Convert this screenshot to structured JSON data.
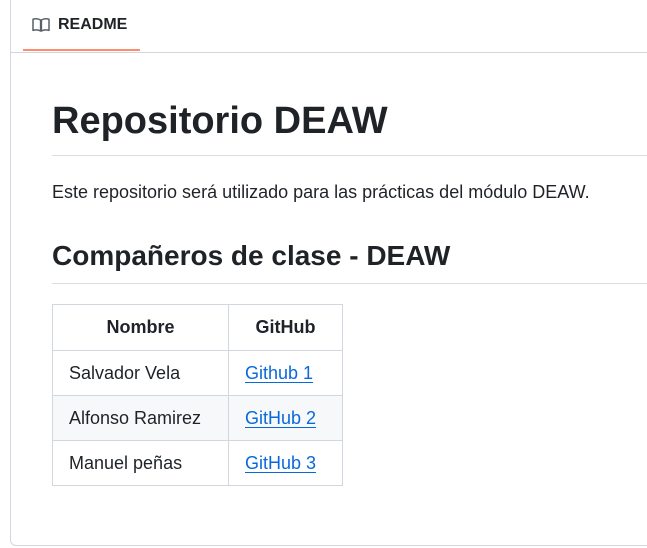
{
  "tab": {
    "label": "README",
    "icon": "book-icon",
    "accent": "#fd8c73"
  },
  "readme": {
    "title": "Repositorio DEAW",
    "intro": "Este repositorio será utilizado para las prácticas del módulo DEAW.",
    "section_title": "Compañeros de clase - DEAW",
    "table": {
      "headers": [
        "Nombre",
        "GitHub"
      ],
      "rows": [
        {
          "name": "Salvador Vela",
          "link": "Github 1"
        },
        {
          "name": "Alfonso Ramirez",
          "link": "GitHub 2"
        },
        {
          "name": "Manuel peñas",
          "link": "GitHub 3"
        }
      ]
    }
  },
  "colors": {
    "link": "#0969da",
    "text": "#1f2328",
    "border": "#d0d7de",
    "row_alt": "#f6f8fa"
  }
}
